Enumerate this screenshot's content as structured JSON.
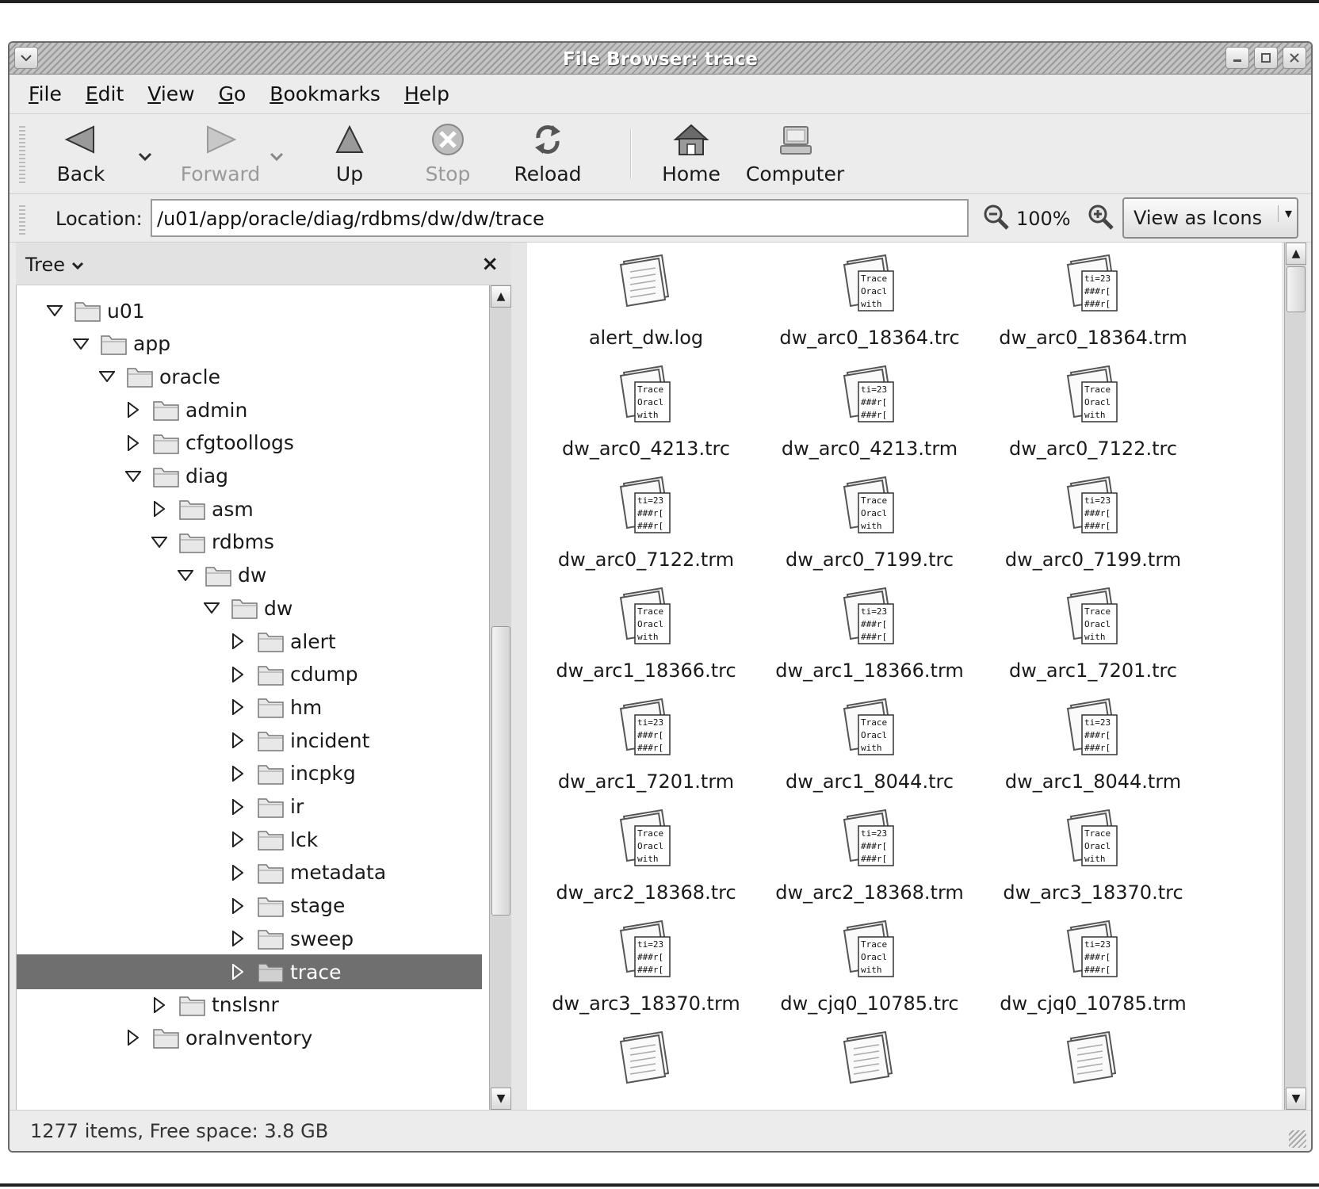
{
  "window": {
    "title": "File Browser: trace"
  },
  "menubar": [
    {
      "label": "File",
      "mnemonic": "F",
      "rest": "ile"
    },
    {
      "label": "Edit",
      "mnemonic": "E",
      "rest": "dit"
    },
    {
      "label": "View",
      "mnemonic": "V",
      "rest": "iew"
    },
    {
      "label": "Go",
      "mnemonic": "G",
      "rest": "o"
    },
    {
      "label": "Bookmarks",
      "mnemonic": "B",
      "rest": "ookmarks"
    },
    {
      "label": "Help",
      "mnemonic": "H",
      "rest": "elp"
    }
  ],
  "toolbar": {
    "back": {
      "label": "Back",
      "icon": "back-arrow-icon"
    },
    "forward": {
      "label": "Forward",
      "icon": "forward-arrow-icon",
      "enabled": false
    },
    "up": {
      "label": "Up",
      "icon": "up-arrow-icon"
    },
    "stop": {
      "label": "Stop",
      "icon": "stop-icon",
      "enabled": false
    },
    "reload": {
      "label": "Reload",
      "icon": "reload-icon"
    },
    "home": {
      "label": "Home",
      "icon": "home-icon"
    },
    "computer": {
      "label": "Computer",
      "icon": "computer-icon"
    }
  },
  "location": {
    "label": "Location:",
    "value": "/u01/app/oracle/diag/rdbms/dw/dw/trace",
    "zoom": "100%",
    "view_mode": "View as Icons"
  },
  "sidepane": {
    "title": "Tree",
    "close_glyph": "×",
    "tree": [
      {
        "label": "u01",
        "depth": 0,
        "expanded": true
      },
      {
        "label": "app",
        "depth": 1,
        "expanded": true
      },
      {
        "label": "oracle",
        "depth": 2,
        "expanded": true
      },
      {
        "label": "admin",
        "depth": 3,
        "expanded": false
      },
      {
        "label": "cfgtoollogs",
        "depth": 3,
        "expanded": false
      },
      {
        "label": "diag",
        "depth": 3,
        "expanded": true
      },
      {
        "label": "asm",
        "depth": 4,
        "expanded": false
      },
      {
        "label": "rdbms",
        "depth": 4,
        "expanded": true
      },
      {
        "label": "dw",
        "depth": 5,
        "expanded": true
      },
      {
        "label": "dw",
        "depth": 6,
        "expanded": true
      },
      {
        "label": "alert",
        "depth": 7,
        "expanded": false
      },
      {
        "label": "cdump",
        "depth": 7,
        "expanded": false
      },
      {
        "label": "hm",
        "depth": 7,
        "expanded": false
      },
      {
        "label": "incident",
        "depth": 7,
        "expanded": false
      },
      {
        "label": "incpkg",
        "depth": 7,
        "expanded": false
      },
      {
        "label": "ir",
        "depth": 7,
        "expanded": false
      },
      {
        "label": "lck",
        "depth": 7,
        "expanded": false
      },
      {
        "label": "metadata",
        "depth": 7,
        "expanded": false
      },
      {
        "label": "stage",
        "depth": 7,
        "expanded": false
      },
      {
        "label": "sweep",
        "depth": 7,
        "expanded": false
      },
      {
        "label": "trace",
        "depth": 7,
        "expanded": false,
        "selected": true
      },
      {
        "label": "tnslsnr",
        "depth": 4,
        "expanded": false
      },
      {
        "label": "oraInventory",
        "depth": 3,
        "expanded": false
      }
    ]
  },
  "files": [
    {
      "name": "alert_dw.log",
      "kind": "plain"
    },
    {
      "name": "dw_arc0_18364.trc",
      "kind": "trace"
    },
    {
      "name": "dw_arc0_18364.trm",
      "kind": "map"
    },
    {
      "name": "dw_arc0_4213.trc",
      "kind": "trace"
    },
    {
      "name": "dw_arc0_4213.trm",
      "kind": "map"
    },
    {
      "name": "dw_arc0_7122.trc",
      "kind": "trace"
    },
    {
      "name": "dw_arc0_7122.trm",
      "kind": "map"
    },
    {
      "name": "dw_arc0_7199.trc",
      "kind": "trace"
    },
    {
      "name": "dw_arc0_7199.trm",
      "kind": "map"
    },
    {
      "name": "dw_arc1_18366.trc",
      "kind": "trace"
    },
    {
      "name": "dw_arc1_18366.trm",
      "kind": "map"
    },
    {
      "name": "dw_arc1_7201.trc",
      "kind": "trace"
    },
    {
      "name": "dw_arc1_7201.trm",
      "kind": "map"
    },
    {
      "name": "dw_arc1_8044.trc",
      "kind": "trace"
    },
    {
      "name": "dw_arc1_8044.trm",
      "kind": "map"
    },
    {
      "name": "dw_arc2_18368.trc",
      "kind": "trace"
    },
    {
      "name": "dw_arc2_18368.trm",
      "kind": "map"
    },
    {
      "name": "dw_arc3_18370.trc",
      "kind": "trace"
    },
    {
      "name": "dw_arc3_18370.trm",
      "kind": "map"
    },
    {
      "name": "dw_cjq0_10785.trc",
      "kind": "trace"
    },
    {
      "name": "dw_cjq0_10785.trm",
      "kind": "map"
    }
  ],
  "icon_text": {
    "trace": [
      "Trace",
      "Oracl",
      "with"
    ],
    "map": [
      "ti=23",
      "###r[",
      "###r["
    ]
  },
  "statusbar": {
    "text": "1277 items, Free space: 3.8 GB"
  }
}
